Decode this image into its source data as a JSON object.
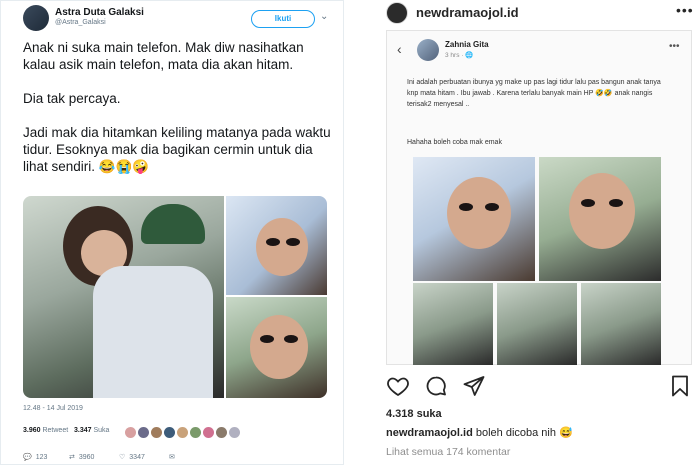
{
  "twitter": {
    "name": "Astra Duta Galaksi",
    "handle": "@Astra_Galaksi",
    "follow_label": "Ikuti",
    "text": "Anak ni suka main telefon. Mak diw nasihatkan kalau asik main telefon, mata dia akan hitam.\n\nDia tak percaya.\n\nJadi mak dia hitamkan keliling matanya pada waktu tidur. Esoknya mak dia bagikan cermin untuk dia lihat sendiri. 😂😭🤪",
    "timestamp": "12.48 - 14 Jul 2019",
    "retweet_count": "3.960",
    "retweet_label": "Retweet",
    "like_count": "3.347",
    "like_label": "Suka",
    "reply_count": "123",
    "retweet_action_count": "3960",
    "like_action_count": "3347",
    "avatar_colors": [
      "#d8a0a0",
      "#6b6b8a",
      "#a07c5c",
      "#3d5c7a",
      "#c9a27a",
      "#7a9a6a",
      "#d07090",
      "#8a7a6a",
      "#b0b0c0"
    ]
  },
  "instagram": {
    "username": "newdramaojol.id",
    "fb_post": {
      "name": "Zahnia Gita",
      "time": "3 hrs · 🌐",
      "text": "Ini adalah perbuatan ibunya yg make up pas lagi tidur lalu pas bangun anak tanya knp mata hitam . Ibu jawab . Karena terlalu banyak main HP 🤣🤣 anak nangis terisak2 menyesal ..",
      "text2": "Hahaha boleh coba mak emak"
    },
    "likes": "4.318 suka",
    "caption_user": "newdramaojol.id",
    "caption_text": " boleh dicoba nih 😅",
    "comments_link": "Lihat semua 174 komentar"
  }
}
